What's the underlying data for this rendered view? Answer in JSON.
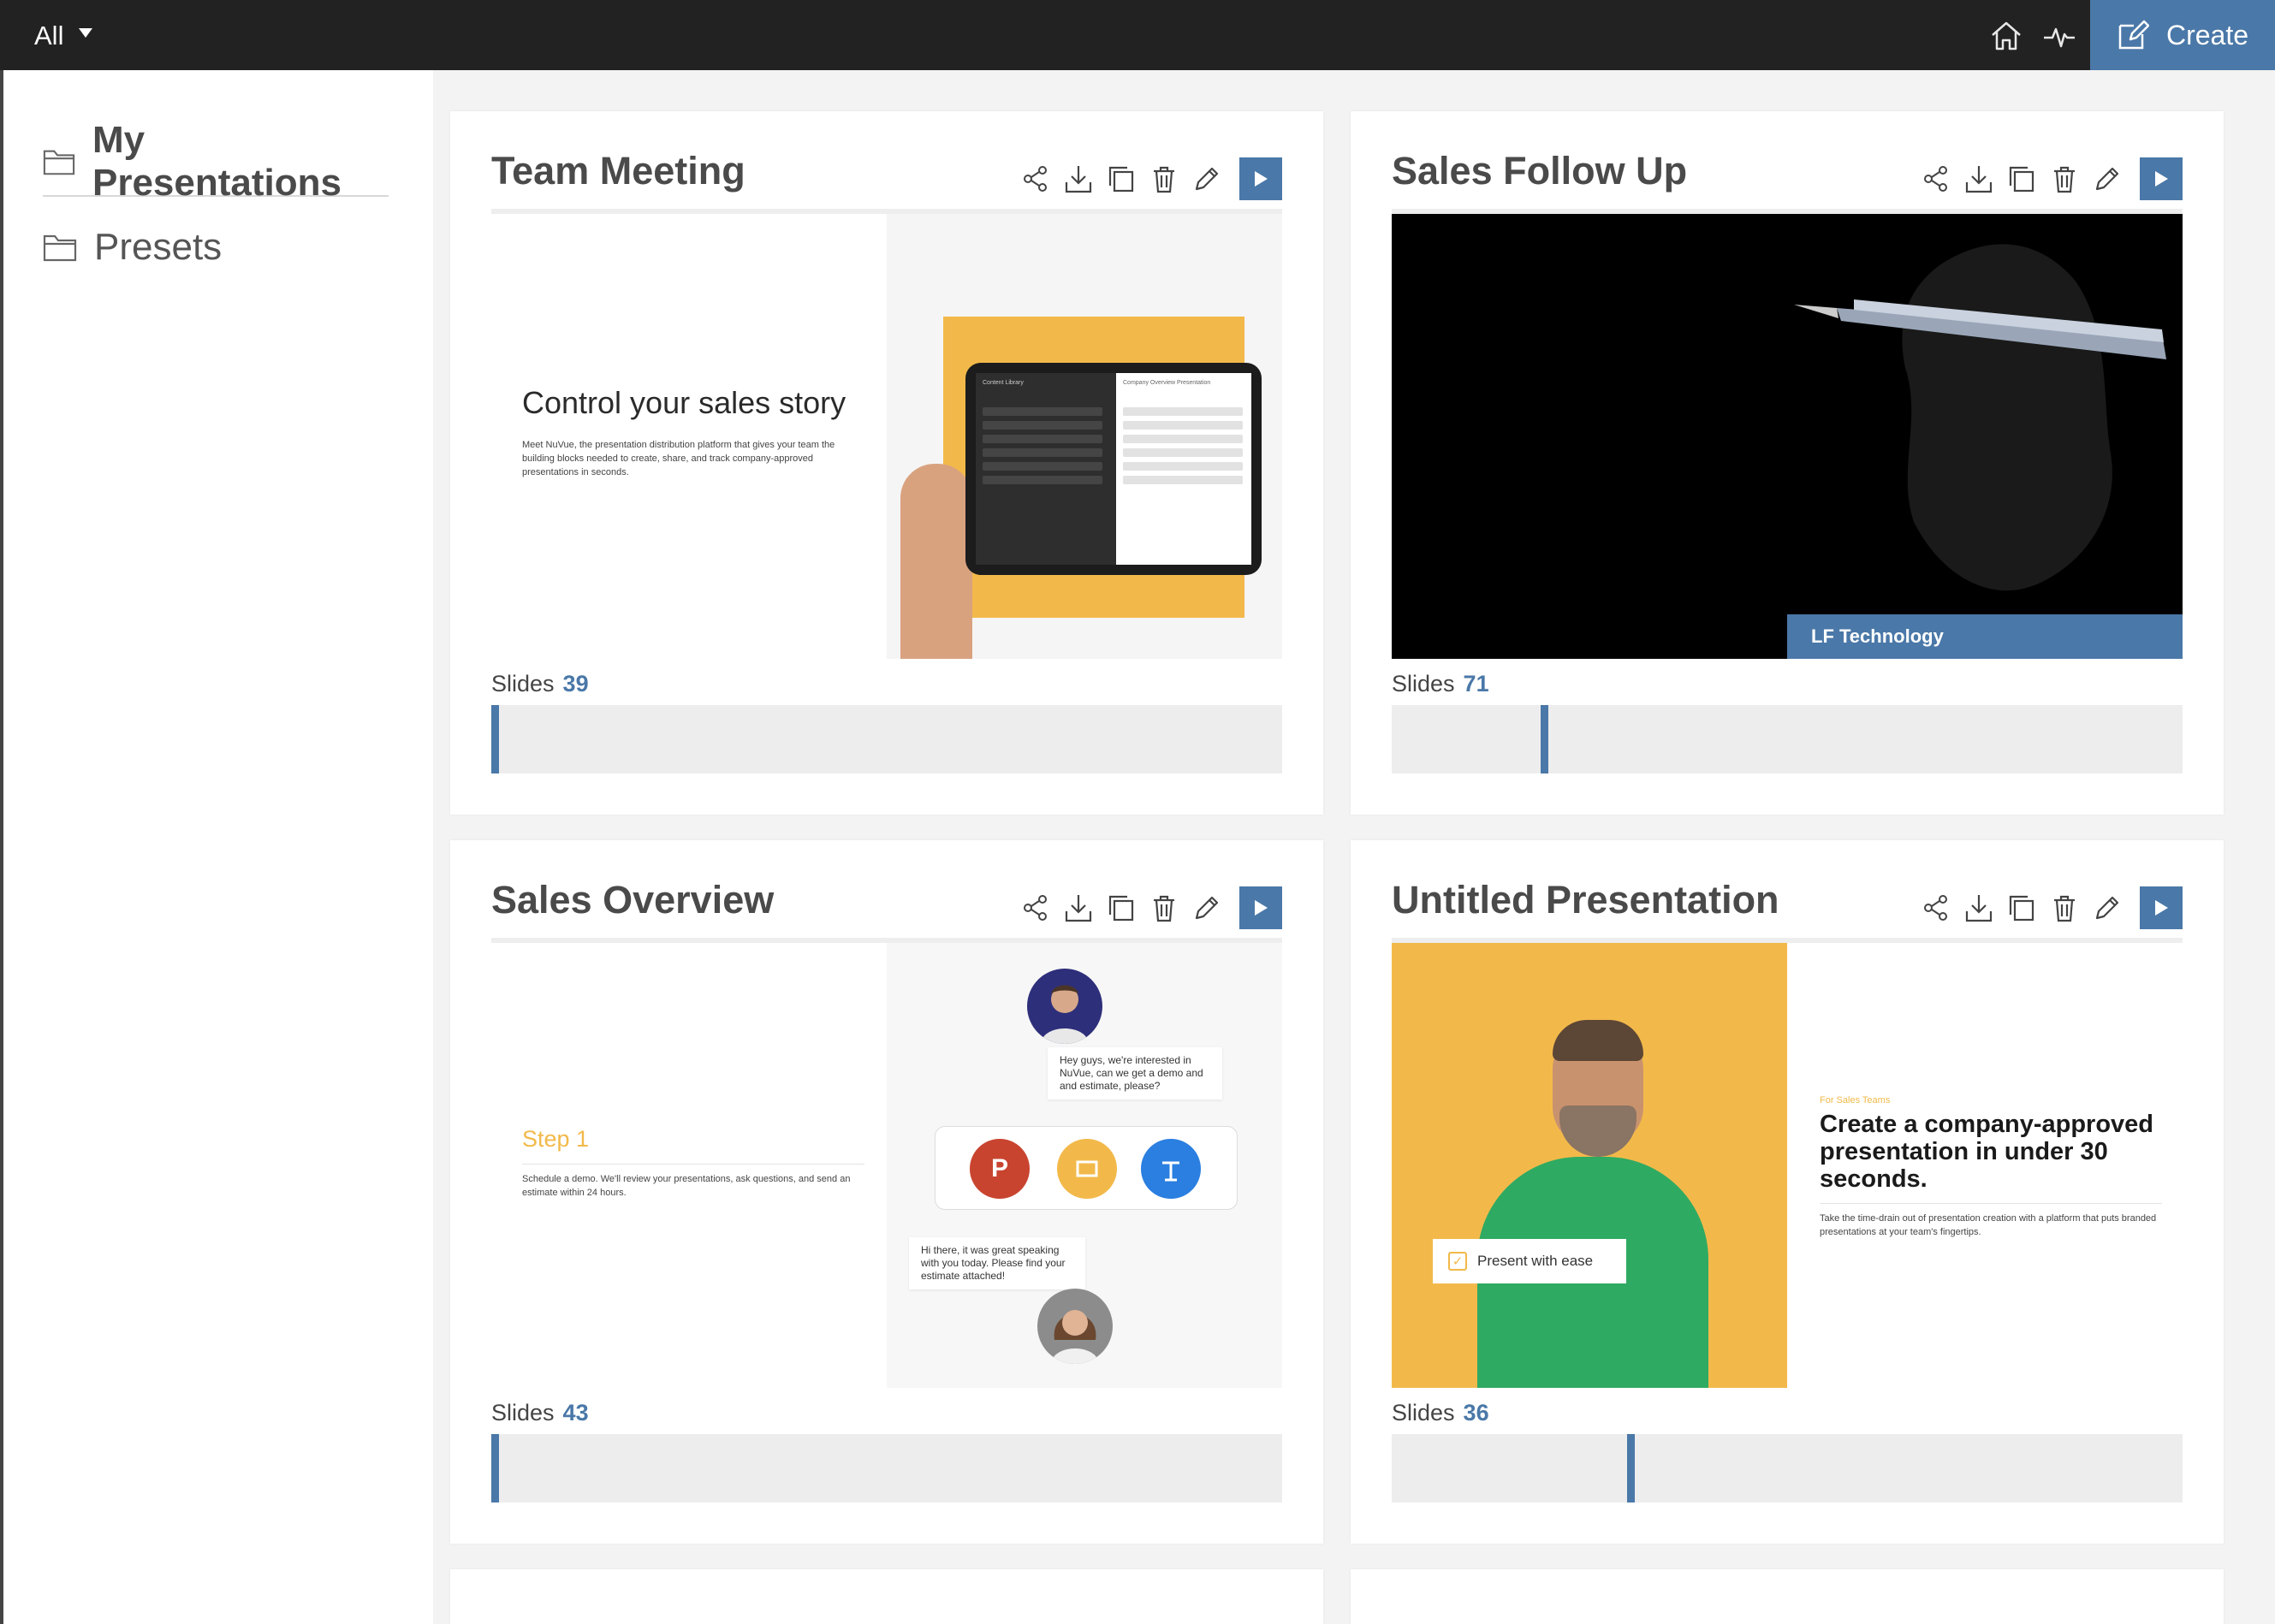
{
  "topbar": {
    "filter_label": "All",
    "create_label": "Create",
    "icons": [
      "home-icon",
      "activity-icon",
      "edit-icon"
    ]
  },
  "sidebar": {
    "items": [
      {
        "label": "My Presentations",
        "icon": "folder-icon",
        "active": true
      },
      {
        "label": "Presets",
        "icon": "folder-icon",
        "active": false
      }
    ]
  },
  "card_actions": [
    "share-icon",
    "download-icon",
    "copy-icon",
    "delete-icon",
    "edit-icon",
    "play-icon"
  ],
  "slides_label": "Slides",
  "colors": {
    "accent": "#4a78a8",
    "topbar": "#222222",
    "yellow": "#f2b94a"
  },
  "cards": [
    {
      "title": "Team Meeting",
      "slides": "39",
      "progress": 0.0,
      "thumbnail": {
        "headline": "Control your sales story",
        "body": "Meet NuVue, the presentation distribution platform that gives your team the building blocks needed to create, share, and track company-approved presentations in seconds.",
        "tablet_left_title": "Content Library",
        "tablet_right_title": "Company Overview Presentation"
      }
    },
    {
      "title": "Sales Follow Up",
      "slides": "71",
      "progress": 0.19,
      "thumbnail": {
        "caption": "LF Technology"
      }
    },
    {
      "title": "Sales Overview",
      "slides": "43",
      "progress": 0.0,
      "thumbnail": {
        "heading": "Step 1",
        "body": "Schedule a demo. We'll review your presentations, ask questions, and send an estimate within 24 hours.",
        "bubble_top": "Hey guys, we're interested in NuVue, can we get a demo and and estimate, please?",
        "bubble_bottom": "Hi there, it was great speaking with you today. Please find your estimate attached!"
      }
    },
    {
      "title": "Untitled Presentation",
      "slides": "36",
      "progress": 0.3,
      "thumbnail": {
        "tag": "Present with ease",
        "eyebrow": "For Sales Teams",
        "headline": "Create a company-approved presentation in under 30 seconds.",
        "body": "Take the time-drain out of presentation creation with a platform that puts branded presentations at your team's fingertips."
      }
    }
  ]
}
